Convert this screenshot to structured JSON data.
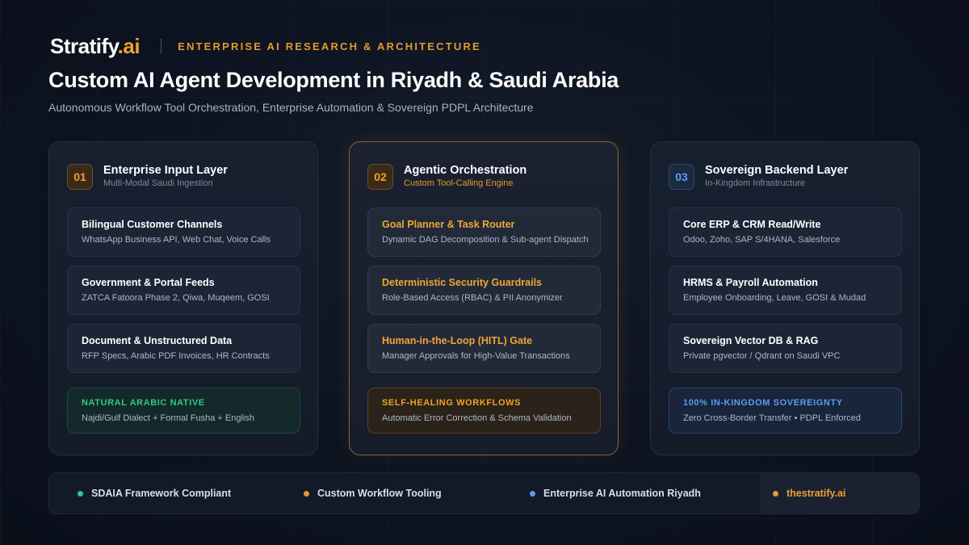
{
  "brand": {
    "logo_main": "Stratify",
    "logo_accent": ".ai",
    "tagline": "ENTERPRISE AI RESEARCH & ARCHITECTURE"
  },
  "title": "Custom AI Agent Development in Riyadh & Saudi Arabia",
  "subtitle": "Autonomous Workflow Tool Orchestration, Enterprise Automation & Sovereign PDPL Architecture",
  "columns": [
    {
      "number": "01",
      "title": "Enterprise Input Layer",
      "subtitle": "Multi-Modal Saudi Ingestion",
      "items": [
        {
          "title": "Bilingual Customer Channels",
          "desc": "WhatsApp Business API, Web Chat, Voice Calls"
        },
        {
          "title": "Government & Portal Feeds",
          "desc": "ZATCA Fatoora Phase 2, Qiwa, Muqeem, GOSI"
        },
        {
          "title": "Document & Unstructured Data",
          "desc": "RFP Specs, Arabic PDF Invoices, HR Contracts"
        }
      ],
      "feature": {
        "title": "NATURAL ARABIC NATIVE",
        "desc": "Najdi/Gulf Dialect + Formal Fusha + English"
      }
    },
    {
      "number": "02",
      "title": "Agentic Orchestration",
      "subtitle": "Custom Tool-Calling Engine",
      "items": [
        {
          "title": "Goal Planner & Task Router",
          "desc": "Dynamic DAG Decomposition & Sub-agent Dispatch"
        },
        {
          "title": "Deterministic Security Guardrails",
          "desc": "Role-Based Access (RBAC) & PII Anonymizer"
        },
        {
          "title": "Human-in-the-Loop (HITL) Gate",
          "desc": "Manager Approvals for High-Value Transactions"
        }
      ],
      "feature": {
        "title": "SELF-HEALING WORKFLOWS",
        "desc": "Automatic Error Correction & Schema Validation"
      }
    },
    {
      "number": "03",
      "title": "Sovereign Backend Layer",
      "subtitle": "In-Kingdom Infrastructure",
      "items": [
        {
          "title": "Core ERP & CRM Read/Write",
          "desc": "Odoo, Zoho, SAP S/4HANA, Salesforce"
        },
        {
          "title": "HRMS & Payroll Automation",
          "desc": "Employee Onboarding, Leave, GOSI & Mudad"
        },
        {
          "title": "Sovereign Vector DB & RAG",
          "desc": "Private pgvector / Qdrant on Saudi VPC"
        }
      ],
      "feature": {
        "title": "100% IN-KINGDOM SOVEREIGNTY",
        "desc": "Zero Cross-Border Transfer • PDPL Enforced"
      }
    }
  ],
  "footer": [
    {
      "label": "SDAIA Framework Compliant",
      "color": "#2ec98a"
    },
    {
      "label": "Custom Workflow Tooling",
      "color": "#e39a2e"
    },
    {
      "label": "Enterprise AI Automation Riyadh",
      "color": "#5d9cf0"
    },
    {
      "label": "thestratify.ai",
      "color": "#e39a2e"
    }
  ]
}
